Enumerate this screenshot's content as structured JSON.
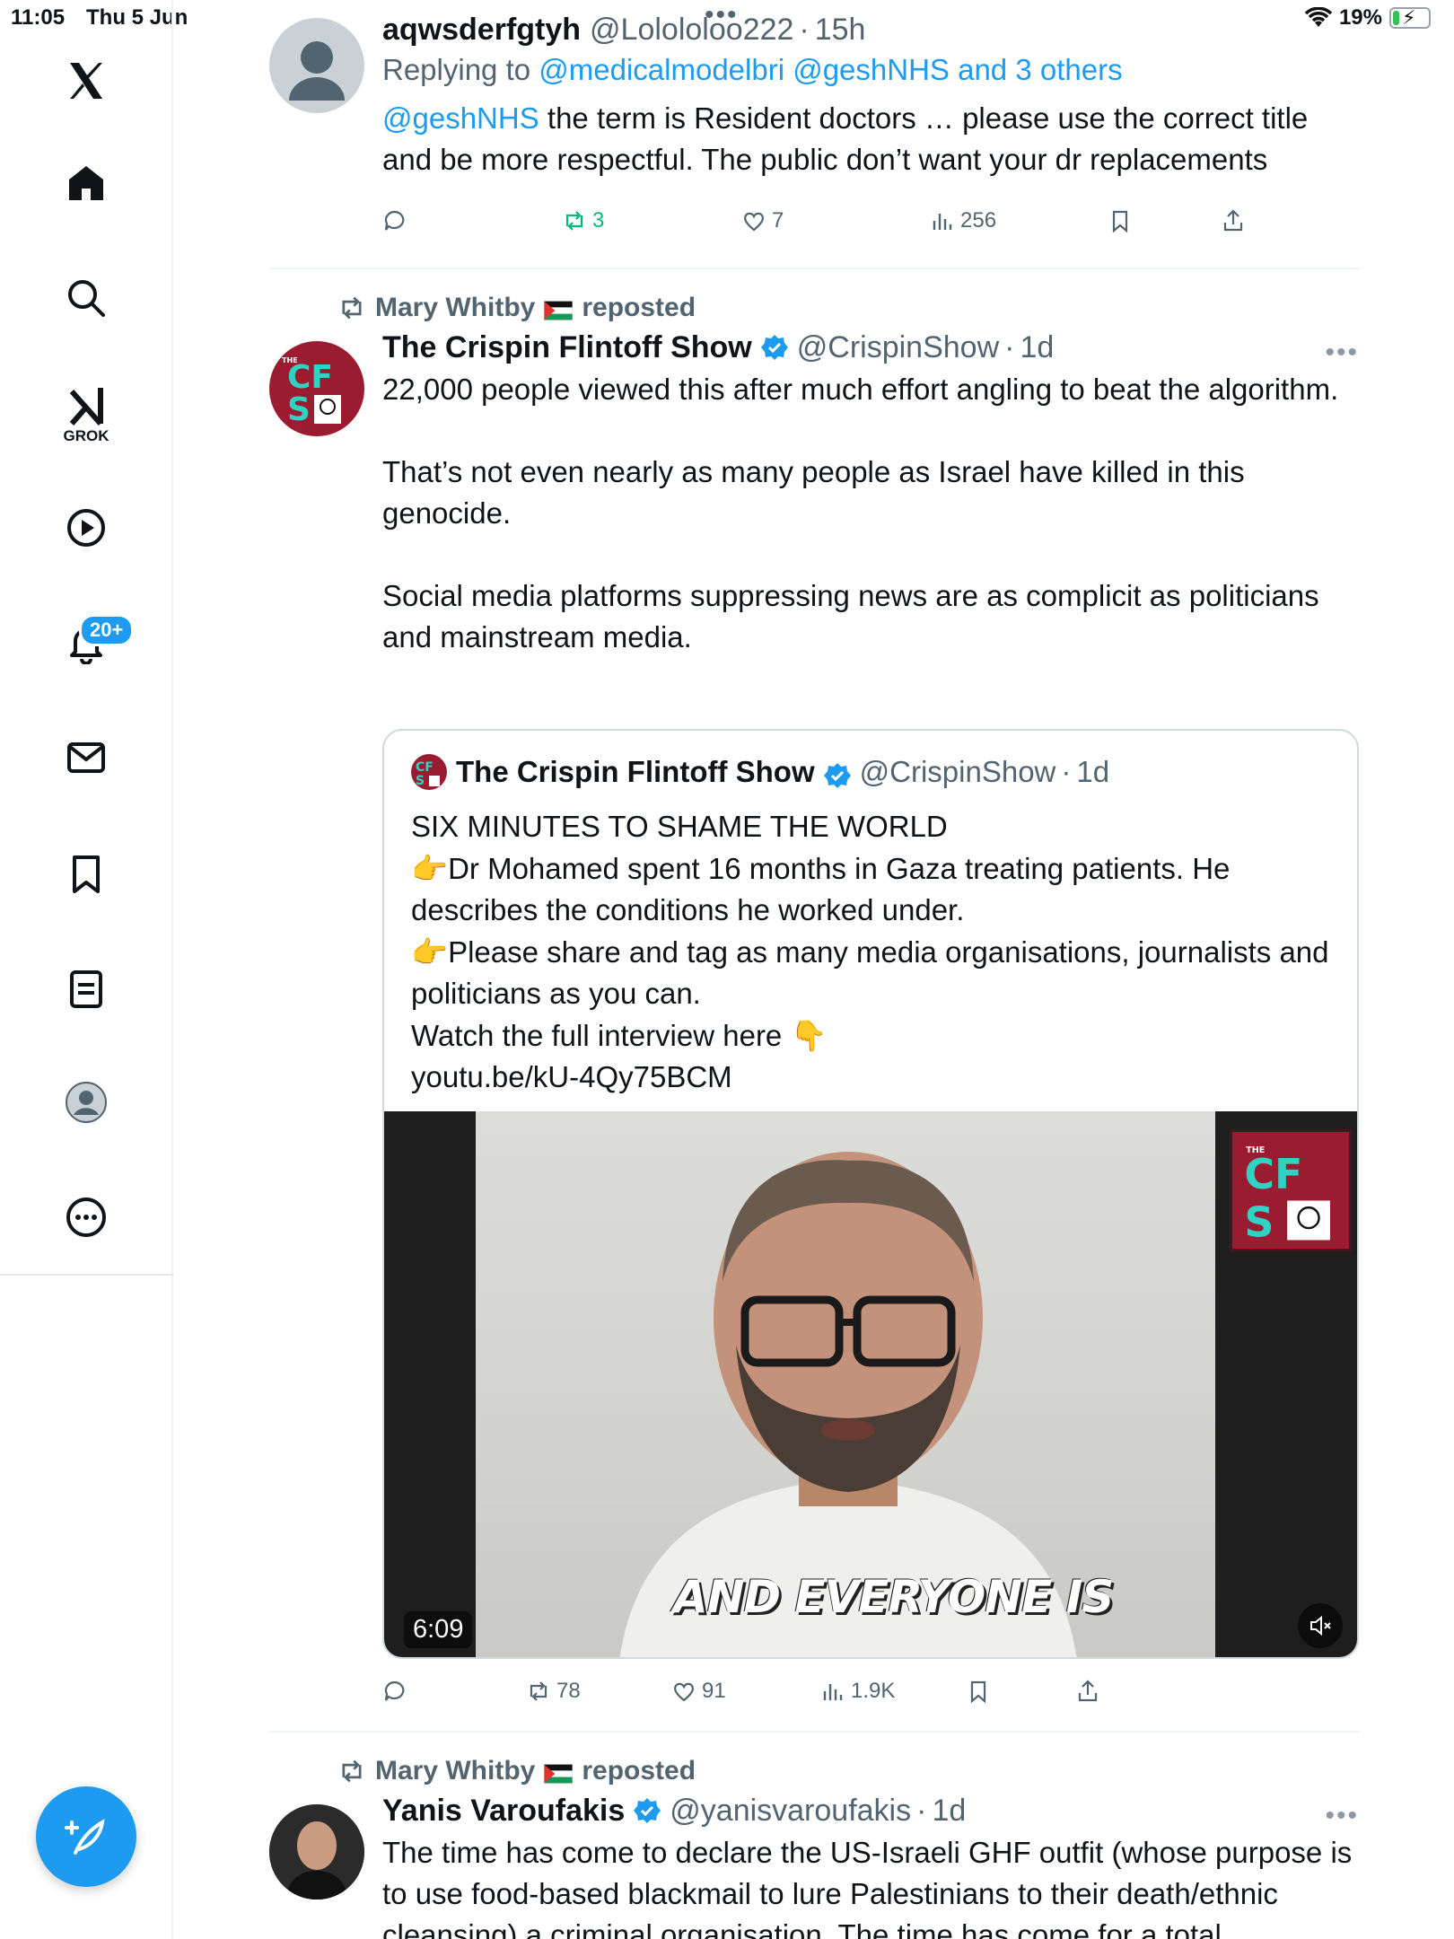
{
  "status_bar": {
    "time": "11:05",
    "date": "Thu 5 Jun",
    "battery": "19%",
    "battery_level": 0.19
  },
  "sidebar": {
    "grok_label": "GROK",
    "notifications_badge": "20+",
    "items": [
      "home",
      "search",
      "grok",
      "video",
      "notifications",
      "messages",
      "bookmarks",
      "lists",
      "profile",
      "more"
    ]
  },
  "tweets": [
    {
      "name": "aqwsderfgtyh",
      "handle": "@Lolololoo222",
      "time": "15h",
      "replying_prefix": "Replying to ",
      "replying_to": "@medicalmodelbri @geshNHS and 3 others",
      "mention": "@geshNHS",
      "text": " the term is Resident doctors … please use the correct title and be more respectful. The public don’t want your dr replacements",
      "replies": "",
      "reposts": "3",
      "likes": "7",
      "views": "256"
    },
    {
      "reposted_by": "Mary Whitby",
      "reposted_label": "reposted",
      "name": "The Crispin Flintoff Show",
      "handle": "@CrispinShow",
      "time": "1d",
      "text_p1": "22,000 people viewed this after much effort angling to beat the algorithm.",
      "text_p2": "That’s not even nearly as many people as Israel have killed in this genocide.",
      "text_p3": "Social media platforms suppressing news are as complicit as politicians and mainstream media.",
      "quote": {
        "name": "The Crispin Flintoff Show",
        "handle": "@CrispinShow",
        "time": "1d",
        "line1": "SIX MINUTES TO SHAME THE WORLD",
        "line2": "👉Dr Mohamed spent 16 months in Gaza treating patients. He describes the conditions he worked under.",
        "line3": "👉Please share and tag as many media organisations, journalists and politicians as you can.",
        "line4": "Watch the full interview here 👇",
        "line5": "youtu.be/kU-4Qy75BCM",
        "video_duration": "6:09",
        "video_caption": "AND EVERYONE IS",
        "logo_text_top": "THE",
        "logo_text": "CF SH"
      },
      "reposts": "78",
      "likes": "91",
      "views": "1.9K"
    },
    {
      "reposted_by": "Mary Whitby",
      "reposted_label": "reposted",
      "name": "Yanis Varoufakis",
      "handle": "@yanisvaroufakis",
      "time": "1d",
      "text": "The time has come to declare the US-Israeli GHF outfit (whose purpose is to use food-based blackmail to lure Palestinians to their death/ethnic cleansing) a criminal organisation. The time has come for a total"
    }
  ],
  "colors": {
    "accent": "#1d9bf0",
    "repost_green": "#00ba7c",
    "muted": "#536471",
    "cfs_red": "#9b1b30",
    "cfs_teal": "#2fd3c4"
  }
}
